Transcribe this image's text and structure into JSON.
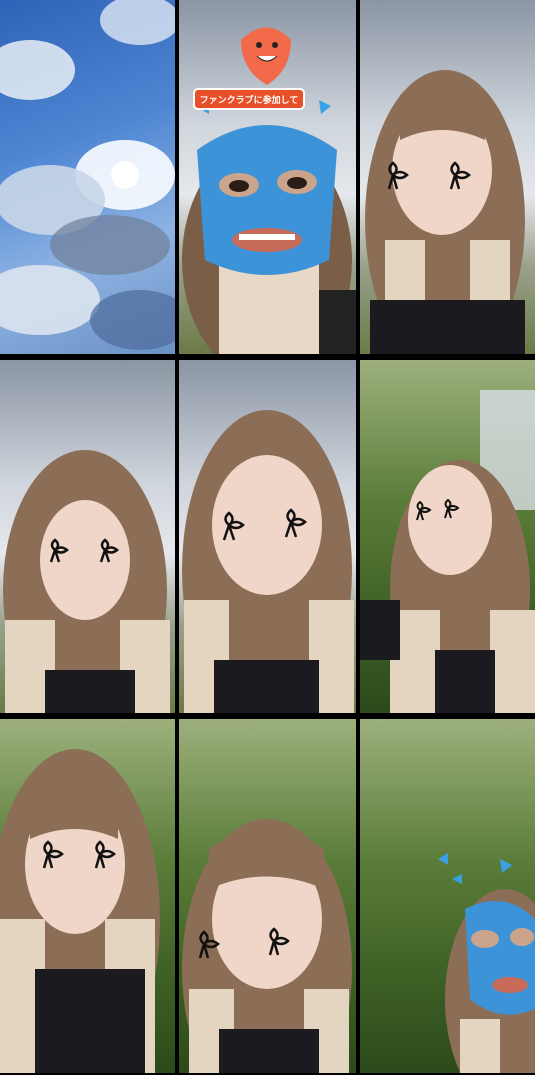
{
  "grid": {
    "rows": 3,
    "cols": 3
  },
  "overlay_badge": {
    "label": "ファンクラブに参加して"
  },
  "colors": {
    "blue_mask": "#3d93d8",
    "badge_bg": "#e8502a",
    "heart": "#f26a4a",
    "hair": "#8b6e55",
    "hair_light": "#e3d5c0",
    "skin": "#f0d6c8",
    "top": "#1b1b1f"
  },
  "cells": [
    {
      "subject": "sky"
    },
    {
      "subject": "blue-mask-filter"
    },
    {
      "subject": "bow-tear-filter"
    },
    {
      "subject": "bow-tear-filter"
    },
    {
      "subject": "bow-tear-filter"
    },
    {
      "subject": "bow-tear-filter"
    },
    {
      "subject": "bow-tear-filter"
    },
    {
      "subject": "bow-tear-filter"
    },
    {
      "subject": "blue-mask-filter"
    }
  ]
}
